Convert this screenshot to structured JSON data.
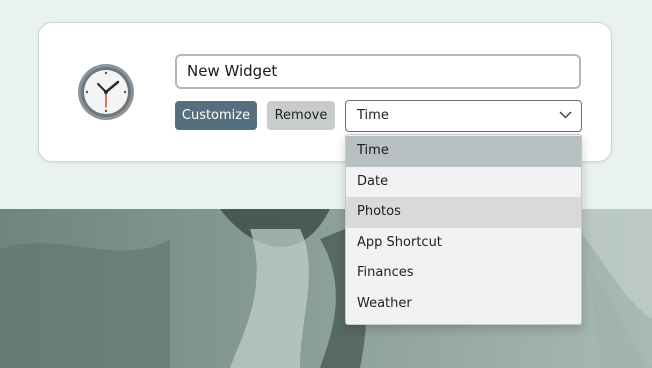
{
  "widget": {
    "icon": "clock-icon",
    "name_value": "New Widget",
    "customize_label": "Customize",
    "remove_label": "Remove",
    "type_select": {
      "selected": "Time",
      "options": [
        "Time",
        "Date",
        "Photos",
        "App Shortcut",
        "Finances",
        "Weather"
      ]
    }
  },
  "colors": {
    "accent": "#55707c",
    "secondary_button": "#c9cccc",
    "selected_option": "#b8bfc3",
    "hover_option": "#d9d9d9"
  }
}
